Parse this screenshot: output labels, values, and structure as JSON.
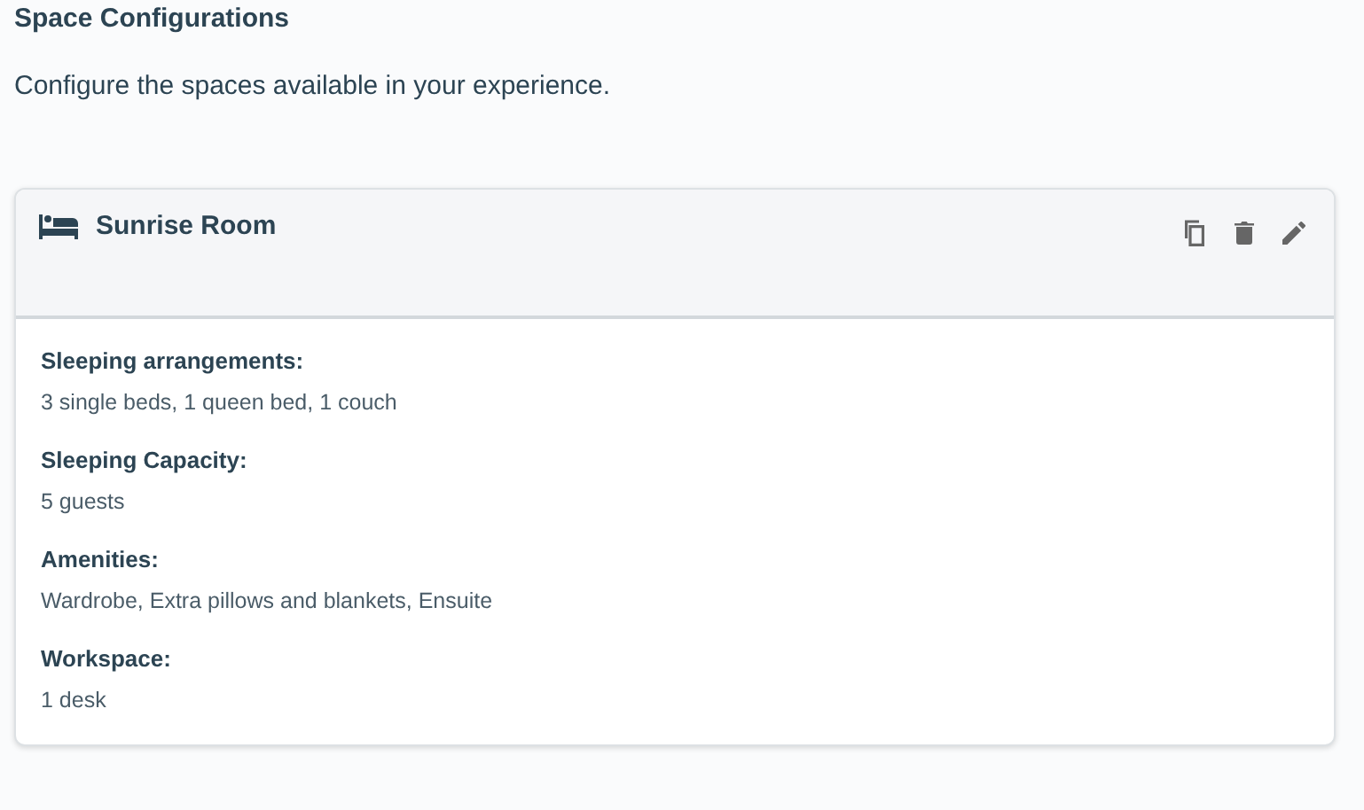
{
  "heading": "Space Configurations",
  "description": "Configure the spaces available in your experience.",
  "space": {
    "title": "Sunrise Room",
    "actions": [
      {
        "kind": "copy"
      },
      {
        "kind": "delete"
      },
      {
        "kind": "edit"
      }
    ],
    "details": [
      {
        "label": "Sleeping arrangements:",
        "value": "3 single beds, 1 queen bed, 1 couch"
      },
      {
        "label": "Sleeping Capacity:",
        "value": "5 guests"
      },
      {
        "label": "Amenities:",
        "value": "Wardrobe, Extra pillows and blankets, Ensuite"
      },
      {
        "label": "Workspace:",
        "value": "1 desk"
      }
    ]
  }
}
